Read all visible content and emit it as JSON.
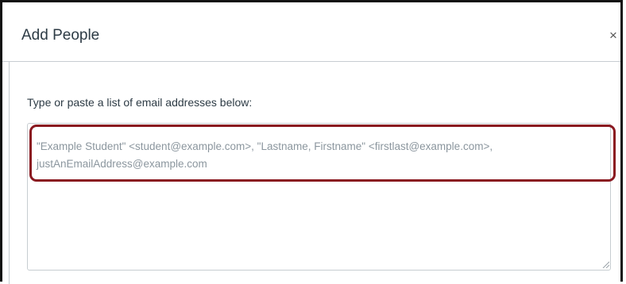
{
  "dialog": {
    "title": "Add People",
    "close_glyph": "×",
    "close_icon": "close-icon"
  },
  "form": {
    "instruction": "Type or paste a list of email addresses below:",
    "textarea_placeholder": "\"Example Student\" <student@example.com>, \"Lastname, Firstname\" <firstlast@example.com>, justAnEmailAddress@example.com",
    "textarea_value": ""
  },
  "annotation": {
    "highlight_color": "#8a1820"
  },
  "colors": {
    "title_text": "#2d3b45",
    "placeholder_text": "#8b969e",
    "border": "#c7cdd1"
  }
}
